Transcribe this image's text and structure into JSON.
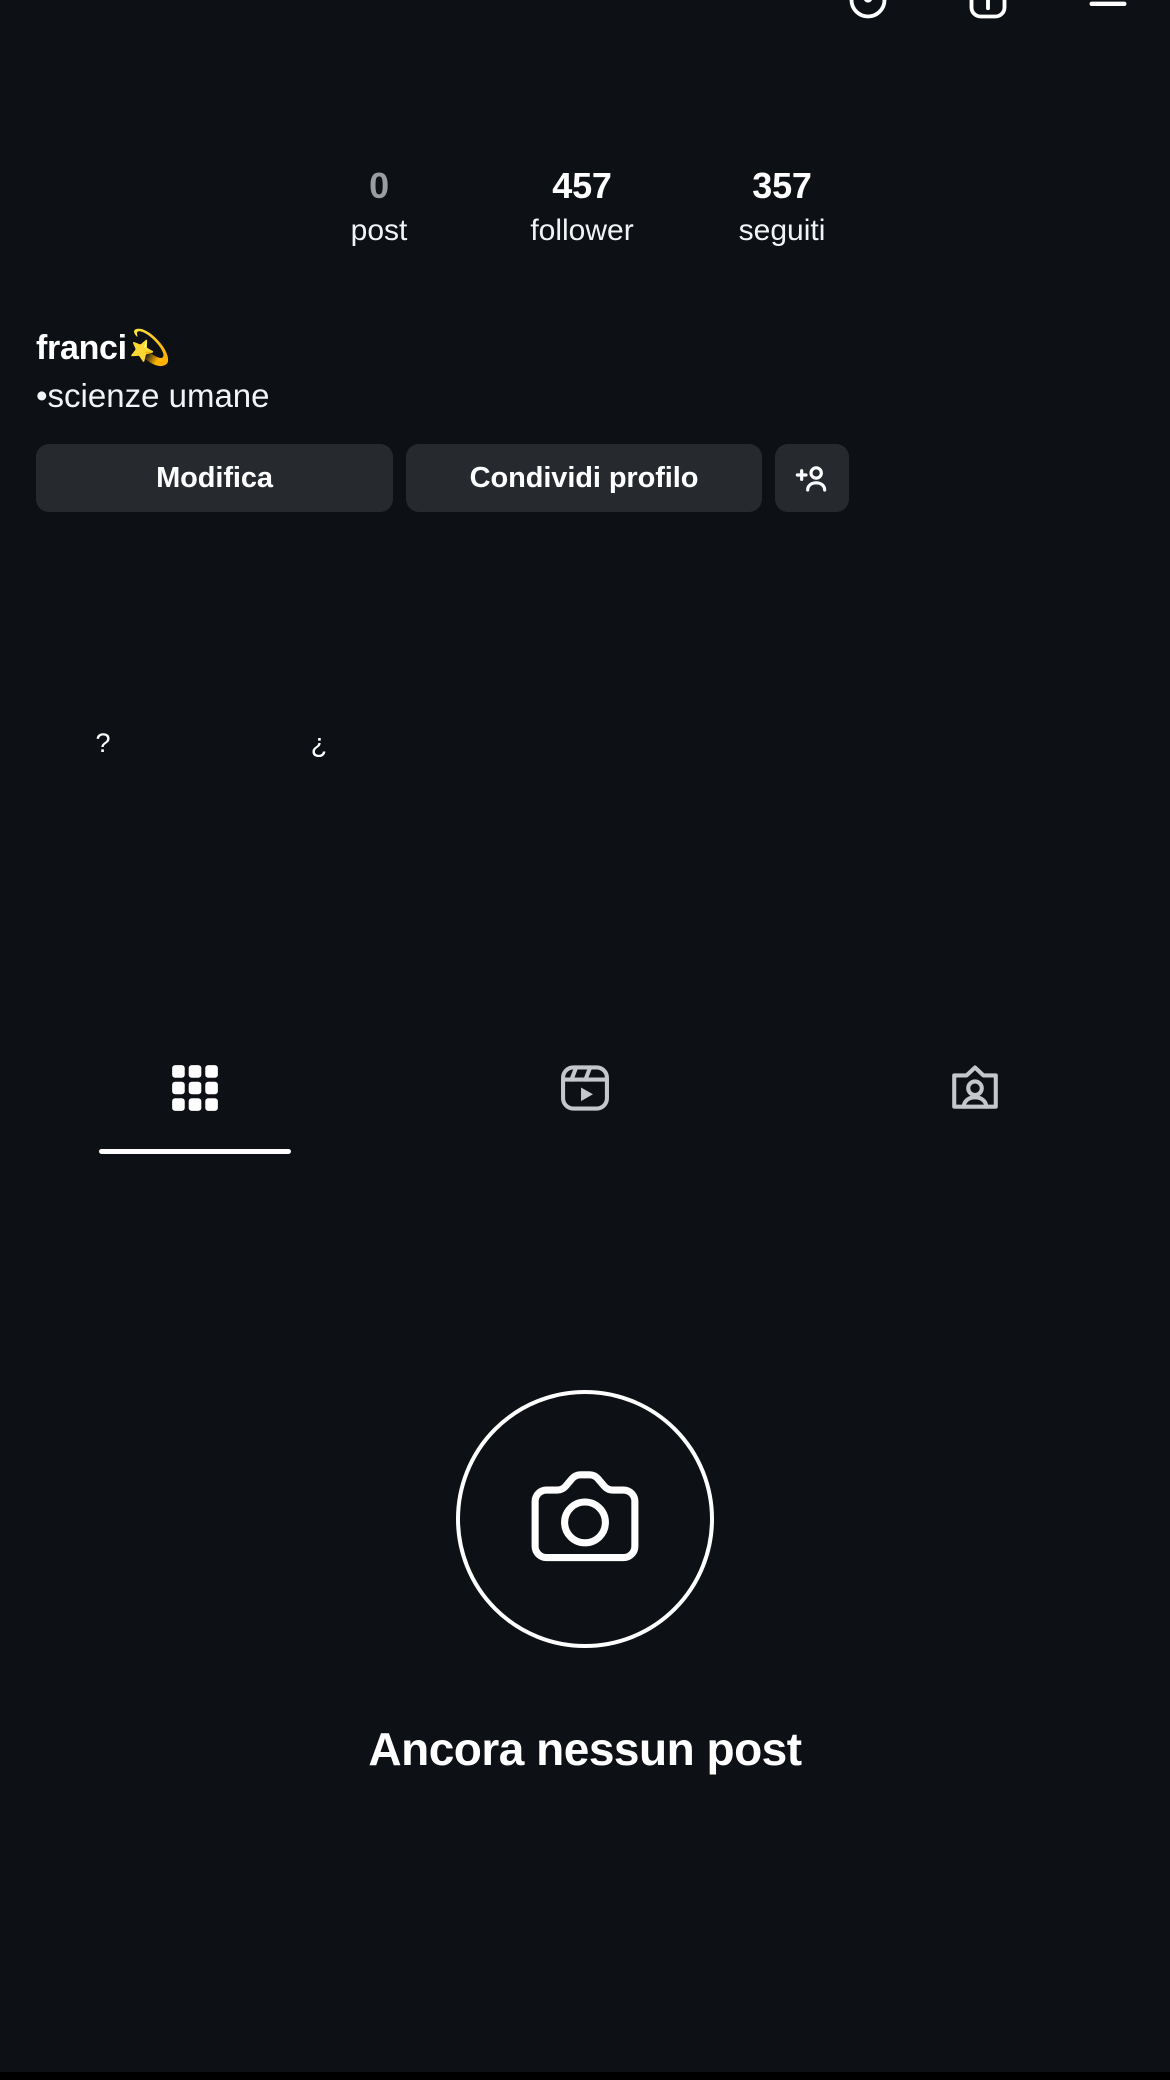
{
  "theme": {
    "background": "#0d1015",
    "surface": "#262a2f",
    "text_primary": "#ffffff",
    "text_secondary": "#f2f3f5",
    "text_muted": "#9a9ea3",
    "icon_inactive": "#c4c8cd"
  },
  "topbar": {
    "icons": [
      {
        "name": "threads-icon",
        "label": "Threads"
      },
      {
        "name": "new-post-icon",
        "label": "Nuovo"
      },
      {
        "name": "menu-icon",
        "label": "Menu"
      }
    ]
  },
  "stats": [
    {
      "value": "0",
      "label": "post",
      "name": "posts"
    },
    {
      "value": "457",
      "label": "follower",
      "name": "followers"
    },
    {
      "value": "357",
      "label": "seguiti",
      "name": "following"
    }
  ],
  "profile": {
    "display_name": "franci",
    "name_emoji": "💫",
    "bio": "•scienze umane"
  },
  "actions": {
    "edit_label": "Modifica",
    "share_label": "Condividi profilo",
    "add_person_icon": "add-person-icon"
  },
  "highlights": [
    {
      "label": "?",
      "name": "highlight-1"
    },
    {
      "label": "¿",
      "name": "highlight-2"
    }
  ],
  "tabs": [
    {
      "name": "tab-grid",
      "icon": "grid-icon",
      "active": true
    },
    {
      "name": "tab-reels",
      "icon": "reels-icon",
      "active": false
    },
    {
      "name": "tab-tagged",
      "icon": "tagged-icon",
      "active": false
    }
  ],
  "empty_state": {
    "icon": "camera-icon",
    "title": "Ancora nessun post"
  }
}
